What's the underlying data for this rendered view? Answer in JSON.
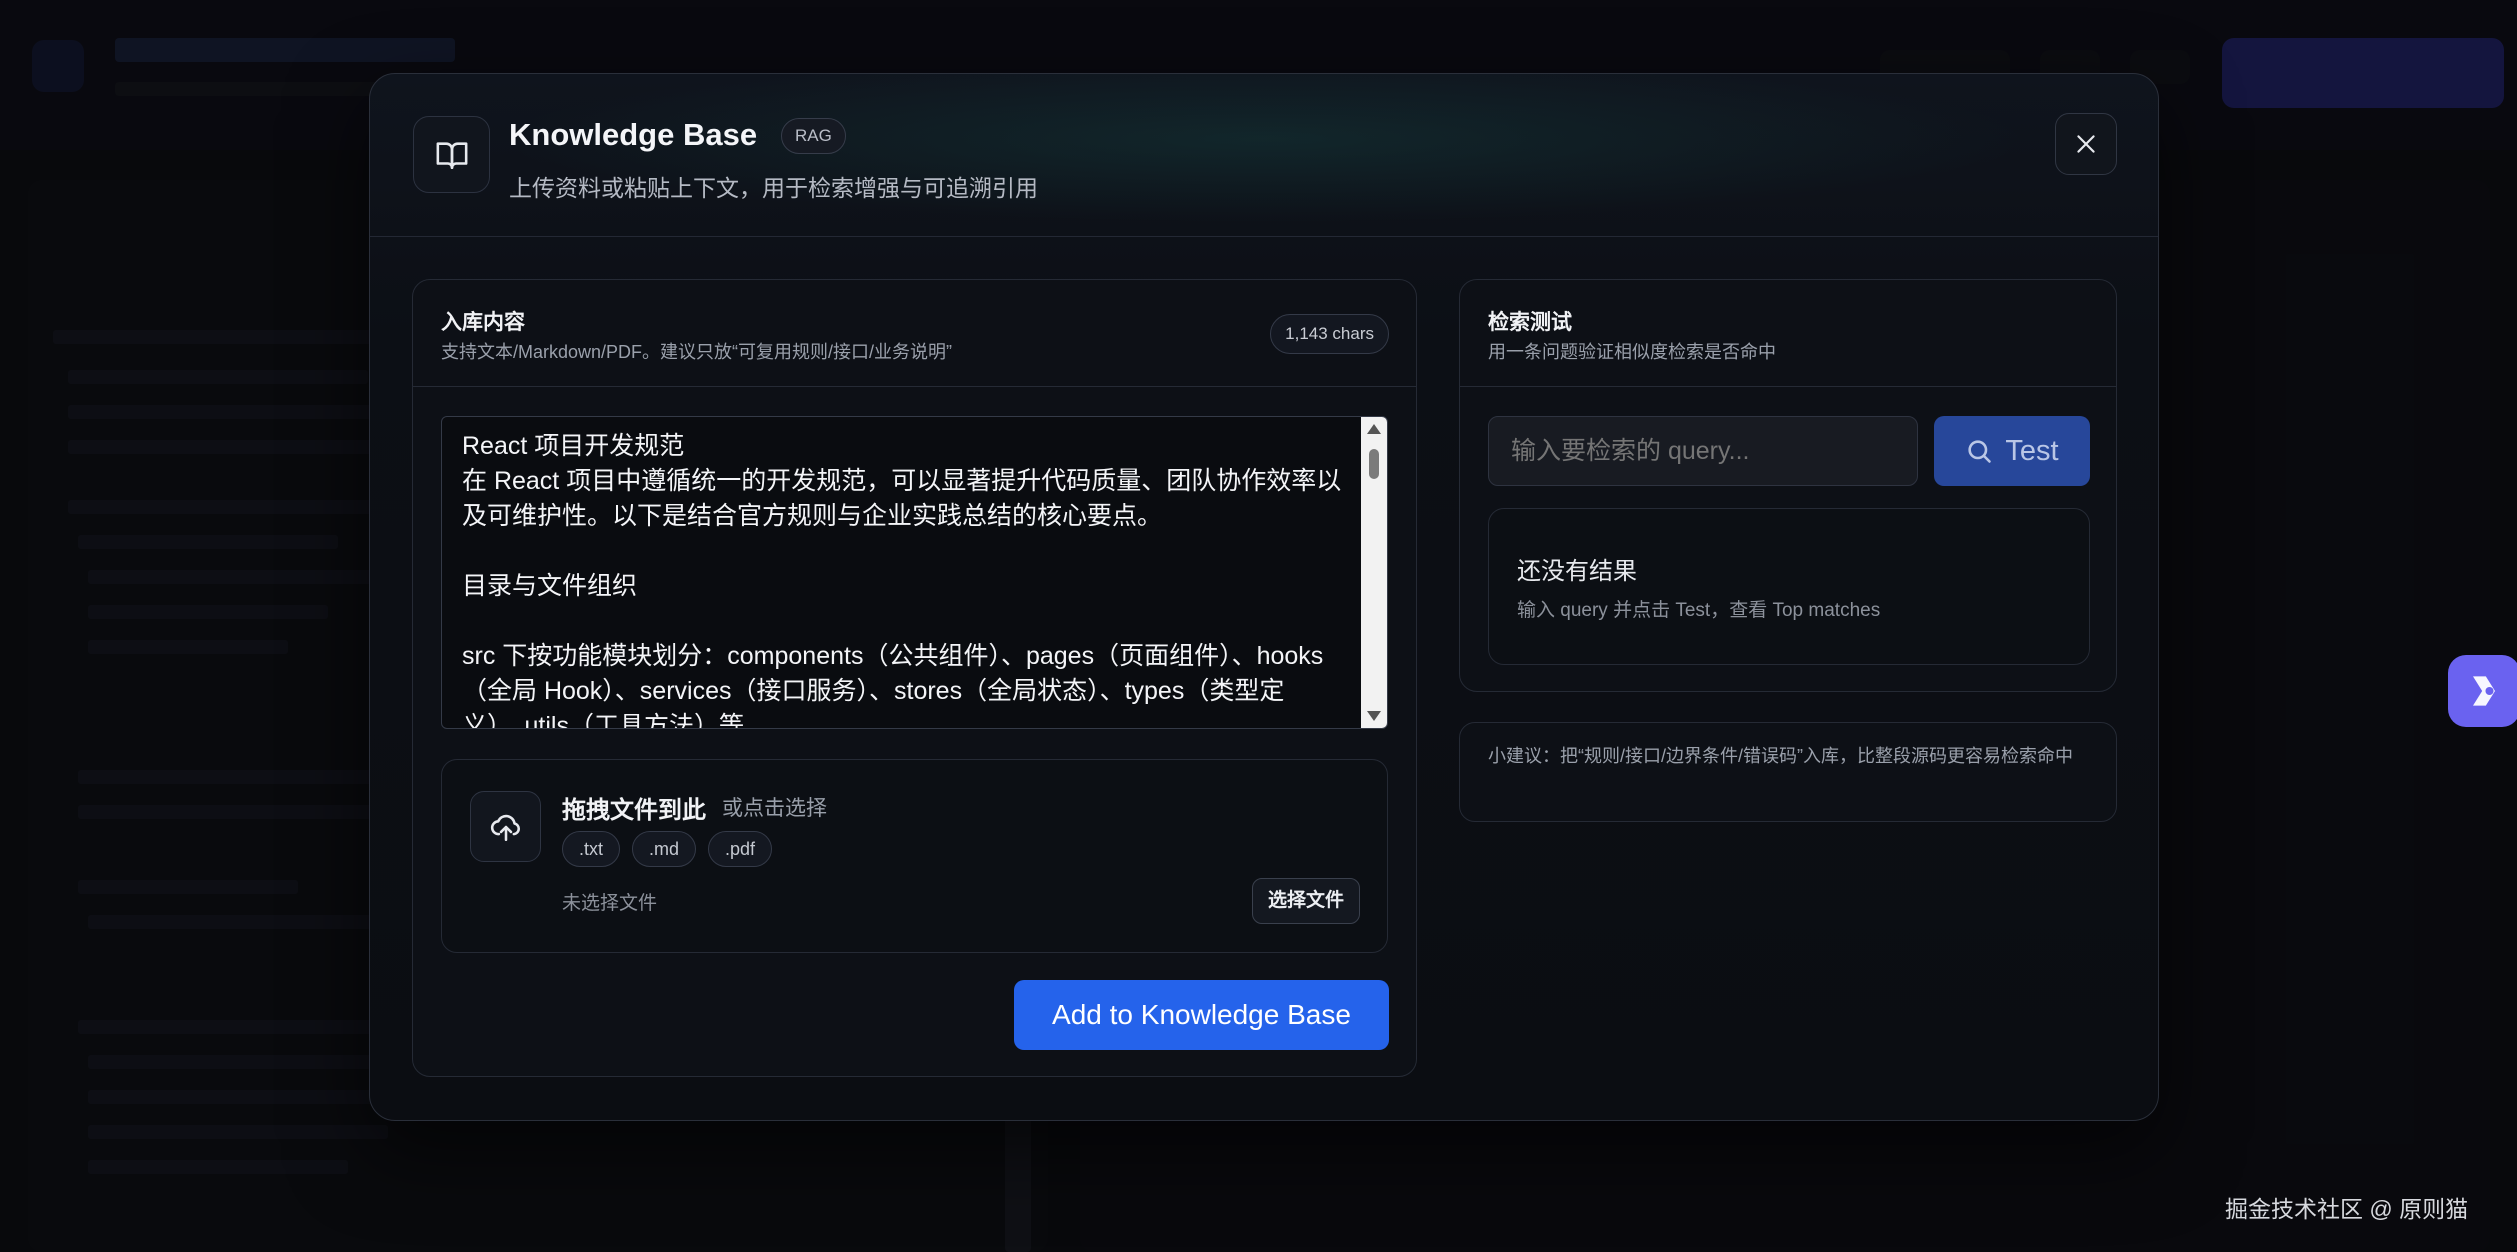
{
  "modal": {
    "title": "Knowledge Base",
    "badge": "RAG",
    "subtitle": "上传资料或粘贴上下文，用于检索增强与可追溯引用",
    "close_icon": "close-icon",
    "title_icon": "book-open-icon"
  },
  "ingest": {
    "title": "入库内容",
    "subtitle": "支持文本/Markdown/PDF。建议只放“可复用规则/接口/业务说明”",
    "char_count": "1,143 chars",
    "content": "React 项目开发规范\n在 React 项目中遵循统一的开发规范，可以显著提升代码质量、团队协作效率以及可维护性。以下是结合官方规则与企业实践总结的核心要点。\n\n目录与文件组织\n\nsrc 下按功能模块划分：components（公共组件）、pages（页面组件）、hooks（全局 Hook）、services（接口服务）、stores（全局状态）、types（类型定义）、utils（工具方法）等",
    "upload": {
      "icon": "upload-cloud-icon",
      "title": "拖拽文件到此",
      "hint": "或点击选择",
      "extensions": [
        ".txt",
        ".md",
        ".pdf"
      ],
      "no_file": "未选择文件",
      "choose_label": "选择文件"
    },
    "submit_label": "Add to Knowledge Base"
  },
  "search": {
    "title": "检索测试",
    "subtitle": "用一条问题验证相似度检索是否命中",
    "placeholder": "输入要检索的 query...",
    "test_label": "Test",
    "test_icon": "search-icon",
    "empty_title": "还没有结果",
    "empty_hint": "输入 query 并点击 Test，查看 Top matches"
  },
  "tip": "小建议：把“规则/接口/边界条件/错误码”入库，比整段源码更容易检索命中",
  "watermark": "掘金技术社区 @ 原则猫",
  "colors": {
    "primary": "#2563eb",
    "test_button": "#27479a",
    "float_button": "#6a62f0",
    "background": "#0b0c10"
  }
}
